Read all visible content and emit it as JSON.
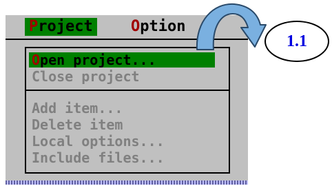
{
  "menubar": {
    "project": {
      "hotkey": "P",
      "rest": "roject"
    },
    "options": {
      "hotkey": "O",
      "rest": "ption"
    }
  },
  "dropdown": {
    "items": [
      {
        "hotkey": "O",
        "rest": "pen project...",
        "enabled": true,
        "selected": true
      },
      {
        "hotkey": "",
        "rest": "Close project",
        "enabled": false,
        "selected": false
      },
      {
        "hotkey": "",
        "rest": "Add item...",
        "enabled": false,
        "selected": false
      },
      {
        "hotkey": "",
        "rest": "Delete item",
        "enabled": false,
        "selected": false
      },
      {
        "hotkey": "",
        "rest": "Local options...",
        "enabled": false,
        "selected": false
      },
      {
        "hotkey": "",
        "rest": "Include files...",
        "enabled": false,
        "selected": false
      }
    ]
  },
  "annotation": {
    "label": "1.1",
    "arrow_color": "#7ab0e0",
    "label_color": "#0000e0"
  },
  "colors": {
    "screen": "#c0c0c0",
    "highlight": "#008000",
    "hotkey": "#a00000",
    "disabled": "#808080"
  }
}
